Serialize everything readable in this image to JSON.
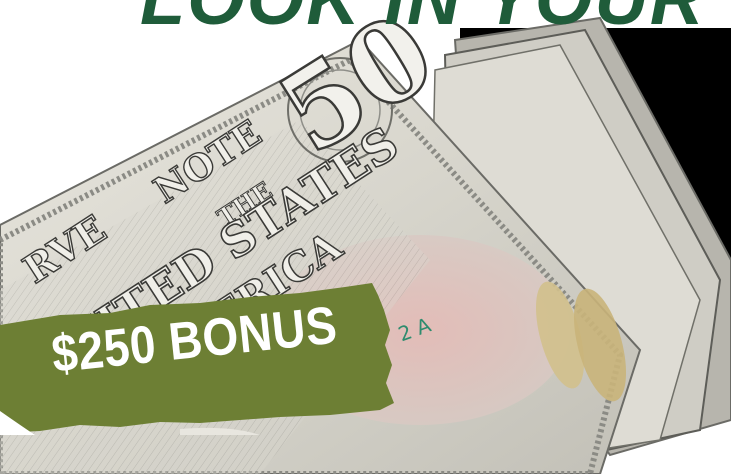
{
  "headline": {
    "text": "LOOK IN YOUR"
  },
  "bill_text": {
    "denomination": "50",
    "line1": "RVE",
    "note": "NOTE",
    "the": "THE",
    "states": "NITED STATES",
    "america": "AMERICA",
    "serial": "2 A"
  },
  "bonus": {
    "label": "$250 BONUS"
  },
  "colors": {
    "headline_green": "#1f5c3a",
    "badge_green": "#6d7f34",
    "rule_green": "#2f6a4a",
    "panel": "#000000"
  }
}
